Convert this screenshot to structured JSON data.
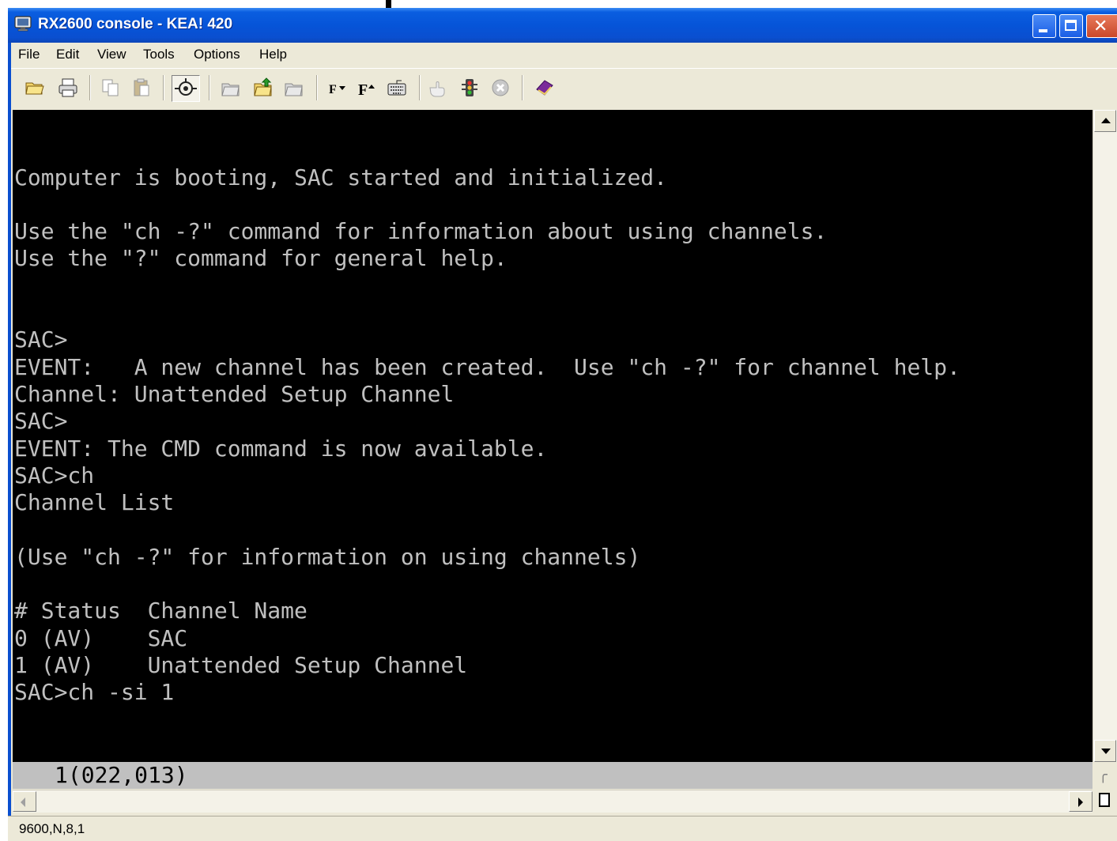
{
  "window": {
    "title": "RX2600 console - KEA! 420",
    "app_icon": "monitor-icon",
    "controls": [
      "minimize-icon",
      "maximize-icon",
      "close-icon"
    ]
  },
  "menu": {
    "items": [
      "File",
      "Edit",
      "View",
      "Tools",
      "Options",
      "Help"
    ]
  },
  "toolbar": {
    "buttons": [
      "open-folder-icon",
      "print-icon",
      "copy-icon",
      "paste-icon",
      "connect-icon",
      "send-file-icon",
      "upload-icon",
      "download-icon",
      "font-decrease-icon",
      "font-increase-icon",
      "keyboard-icon",
      "hand-icon",
      "traffic-light-icon",
      "stop-icon",
      "help-book-icon"
    ]
  },
  "terminal": {
    "lines": [
      "",
      "",
      "Computer is booting, SAC started and initialized.",
      "",
      "Use the \"ch -?\" command for information about using channels.",
      "Use the \"?\" command for general help.",
      "",
      "",
      "SAC>",
      "EVENT:   A new channel has been created.  Use \"ch -?\" for channel help.",
      "Channel: Unattended Setup Channel",
      "SAC>",
      "EVENT: The CMD command is now available.",
      "SAC>ch",
      "Channel List",
      "",
      "(Use \"ch -?\" for information on using channels)",
      "",
      "# Status  Channel Name",
      "0 (AV)    SAC",
      "1 (AV)    Unattended Setup Channel",
      "SAC>ch -si 1"
    ],
    "foreground": "#c0c0c0",
    "background": "#000000",
    "cursor_status": "1(022,013)"
  },
  "statusbar": {
    "connection": "9600,N,8,1"
  },
  "colors": {
    "titlebar": "#0654d8",
    "chrome": "#ece9d8",
    "status_line": "#c0c0c0"
  }
}
